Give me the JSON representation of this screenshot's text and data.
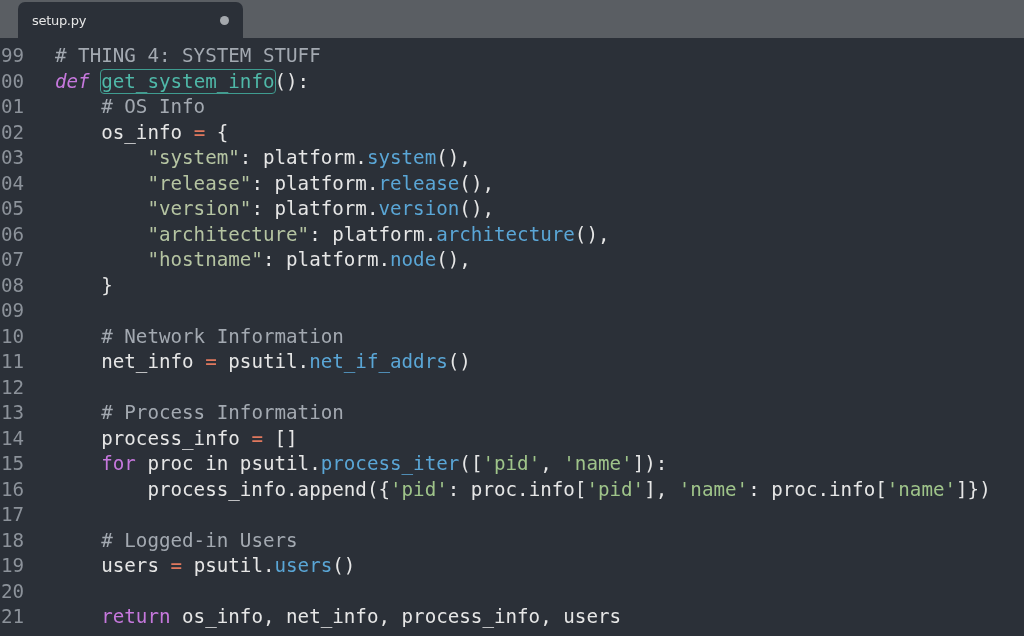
{
  "tab": {
    "title": "setup.py",
    "modified": true
  },
  "lines": [
    {
      "number": "99",
      "tokens": [
        {
          "kind": "comment",
          "text": "# THING 4: SYSTEM STUFF"
        }
      ]
    },
    {
      "number": "00",
      "tokens": [
        {
          "kind": "keyword-italic",
          "text": "def "
        },
        {
          "kind": "match",
          "text": "get_system_info"
        },
        {
          "kind": "plain",
          "text": "():"
        }
      ]
    },
    {
      "number": "01",
      "tokens": [
        {
          "kind": "comment",
          "text": "    # OS Info"
        }
      ]
    },
    {
      "number": "02",
      "tokens": [
        {
          "kind": "plain",
          "text": "    os_info "
        },
        {
          "kind": "operator",
          "text": "="
        },
        {
          "kind": "plain",
          "text": " {"
        }
      ]
    },
    {
      "number": "03",
      "tokens": [
        {
          "kind": "string",
          "text": "        \"system\""
        },
        {
          "kind": "plain",
          "text": ": platform."
        },
        {
          "kind": "method",
          "text": "system"
        },
        {
          "kind": "plain",
          "text": "(),"
        }
      ]
    },
    {
      "number": "04",
      "tokens": [
        {
          "kind": "string",
          "text": "        \"release\""
        },
        {
          "kind": "plain",
          "text": ": platform."
        },
        {
          "kind": "method",
          "text": "release"
        },
        {
          "kind": "plain",
          "text": "(),"
        }
      ]
    },
    {
      "number": "05",
      "tokens": [
        {
          "kind": "string",
          "text": "        \"version\""
        },
        {
          "kind": "plain",
          "text": ": platform."
        },
        {
          "kind": "method",
          "text": "version"
        },
        {
          "kind": "plain",
          "text": "(),"
        }
      ]
    },
    {
      "number": "06",
      "tokens": [
        {
          "kind": "string",
          "text": "        \"architecture\""
        },
        {
          "kind": "plain",
          "text": ": platform."
        },
        {
          "kind": "method",
          "text": "architecture"
        },
        {
          "kind": "plain",
          "text": "(),"
        }
      ]
    },
    {
      "number": "07",
      "tokens": [
        {
          "kind": "string",
          "text": "        \"hostname\""
        },
        {
          "kind": "plain",
          "text": ": platform."
        },
        {
          "kind": "method",
          "text": "node"
        },
        {
          "kind": "plain",
          "text": "(),"
        }
      ]
    },
    {
      "number": "08",
      "tokens": [
        {
          "kind": "plain",
          "text": "    }"
        }
      ]
    },
    {
      "number": "09"
    },
    {
      "number": "10",
      "tokens": [
        {
          "kind": "comment",
          "text": "    # Network Information"
        }
      ]
    },
    {
      "number": "11",
      "tokens": [
        {
          "kind": "plain",
          "text": "    net_info "
        },
        {
          "kind": "operator",
          "text": "="
        },
        {
          "kind": "plain",
          "text": " psutil."
        },
        {
          "kind": "method",
          "text": "net_if_addrs"
        },
        {
          "kind": "plain",
          "text": "()"
        }
      ]
    },
    {
      "number": "12"
    },
    {
      "number": "13",
      "tokens": [
        {
          "kind": "comment",
          "text": "    # Process Information"
        }
      ]
    },
    {
      "number": "14",
      "tokens": [
        {
          "kind": "plain",
          "text": "    process_info "
        },
        {
          "kind": "operator",
          "text": "="
        },
        {
          "kind": "plain",
          "text": " []"
        }
      ]
    },
    {
      "number": "15",
      "tokens": [
        {
          "kind": "keyword",
          "text": "    for"
        },
        {
          "kind": "plain",
          "text": " proc in psutil."
        },
        {
          "kind": "method",
          "text": "process_iter"
        },
        {
          "kind": "plain",
          "text": "(["
        },
        {
          "kind": "quoted",
          "text": "'pid'"
        },
        {
          "kind": "plain",
          "text": ", "
        },
        {
          "kind": "quoted",
          "text": "'name'"
        },
        {
          "kind": "plain",
          "text": "]):"
        }
      ]
    },
    {
      "number": "16",
      "tokens": [
        {
          "kind": "plain",
          "text": "        process_info.append({"
        },
        {
          "kind": "quoted",
          "text": "'pid'"
        },
        {
          "kind": "plain",
          "text": ": proc.info["
        },
        {
          "kind": "quoted",
          "text": "'pid'"
        },
        {
          "kind": "plain",
          "text": "], "
        },
        {
          "kind": "quoted",
          "text": "'name'"
        },
        {
          "kind": "plain",
          "text": ": proc.info["
        },
        {
          "kind": "quoted",
          "text": "'name'"
        },
        {
          "kind": "plain",
          "text": "]})"
        }
      ]
    },
    {
      "number": "17"
    },
    {
      "number": "18",
      "tokens": [
        {
          "kind": "comment",
          "text": "    # Logged-in Users"
        }
      ]
    },
    {
      "number": "19",
      "tokens": [
        {
          "kind": "plain",
          "text": "    users "
        },
        {
          "kind": "operator",
          "text": "="
        },
        {
          "kind": "plain",
          "text": " psutil."
        },
        {
          "kind": "method",
          "text": "users"
        },
        {
          "kind": "plain",
          "text": "()"
        }
      ]
    },
    {
      "number": "20"
    },
    {
      "number": "21",
      "tokens": [
        {
          "kind": "keyword",
          "text": "    return"
        },
        {
          "kind": "plain",
          "text": " os_info, net_info, process_info, users"
        }
      ]
    }
  ]
}
